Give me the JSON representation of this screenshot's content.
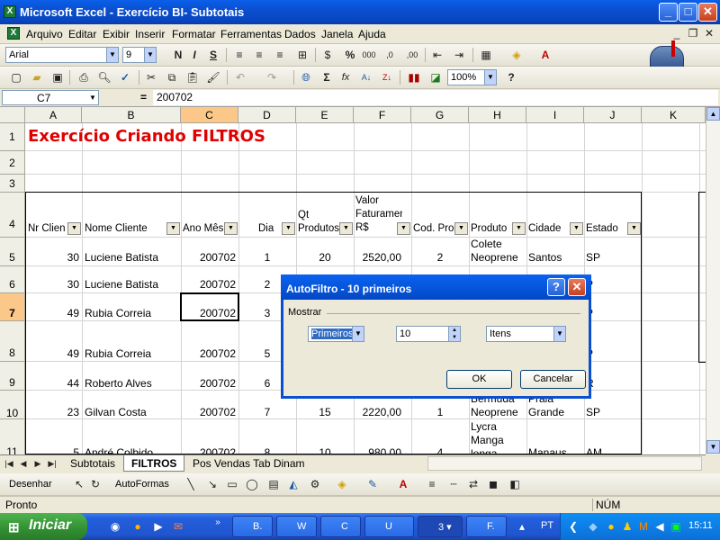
{
  "window": {
    "title": "Microsoft Excel - Exercício BI- Subtotais",
    "min": "_",
    "max": "□",
    "close": "✕"
  },
  "menu": [
    "Arquivo",
    "Editar",
    "Exibir",
    "Inserir",
    "Formatar",
    "Ferramentas",
    "Dados",
    "Janela",
    "Ajuda"
  ],
  "format_toolbar": {
    "font": "Arial",
    "size": "9",
    "bold": "N",
    "italic": "I",
    "underline": "S",
    "percent": "%",
    "thousands": "000"
  },
  "std_toolbar": {
    "zoom": "100%",
    "sigma": "Σ",
    "fx": "fx"
  },
  "formula_bar": {
    "name_box": "C7",
    "equals": "=",
    "value": "200702"
  },
  "columns": [
    "A",
    "B",
    "C",
    "D",
    "E",
    "F",
    "G",
    "H",
    "I",
    "J",
    "K"
  ],
  "rows": [
    "1",
    "2",
    "3",
    "4",
    "5",
    "6",
    "7",
    "8",
    "9",
    "10",
    "11"
  ],
  "sheet_title": "Exercício Criando FILTROS",
  "headers": {
    "nr_cliente": "Nr Clien",
    "nome_cliente": "Nome Cliente",
    "ano_mes": "Ano Mês",
    "dia": "Dia",
    "qt_produtos": "Qt Produtos",
    "faturamento": "Valor Faturamento R$",
    "cod_prod": "Cod. Pro",
    "produto": "Produto",
    "cidade": "Cidade",
    "estado": "Estado"
  },
  "data_rows": [
    {
      "nr": "30",
      "nome": "Luciene Batista",
      "ano": "200702",
      "dia": "1",
      "qt": "20",
      "valor": "2520,00",
      "cod": "2",
      "produto": "Colete Neoprene",
      "cidade": "Santos",
      "estado": "SP"
    },
    {
      "nr": "30",
      "nome": "Luciene Batista",
      "ano": "200702",
      "dia": "2",
      "qt": "",
      "valor": "",
      "cod": "",
      "produto": "",
      "cidade": "",
      "estado": "P"
    },
    {
      "nr": "49",
      "nome": "Rubia Correia",
      "ano": "200702",
      "dia": "3",
      "qt": "",
      "valor": "",
      "cod": "",
      "produto": "",
      "cidade": "",
      "estado": "P"
    },
    {
      "nr": "49",
      "nome": "Rubia Correia",
      "ano": "200702",
      "dia": "5",
      "qt": "",
      "valor": "",
      "cod": "",
      "produto": "",
      "cidade": "",
      "estado": "P"
    },
    {
      "nr": "44",
      "nome": "Roberto Alves",
      "ano": "200702",
      "dia": "6",
      "qt": "",
      "valor": "",
      "cod": "",
      "produto": "",
      "cidade": "",
      "estado": "R"
    },
    {
      "nr": "23",
      "nome": "Gilvan Costa",
      "ano": "200702",
      "dia": "7",
      "qt": "15",
      "valor": "2220,00",
      "cod": "1",
      "produto": "Bermuda Neoprene",
      "cidade": "Praia Grande",
      "estado": "SP"
    },
    {
      "nr": "5",
      "nome": "André Colbido",
      "ano": "200702",
      "dia": "8",
      "qt": "10",
      "valor": "980,00",
      "cod": "4",
      "produto": "Lycra Manga longa",
      "cidade": "Manaus",
      "estado": "AM"
    }
  ],
  "dialog": {
    "title": "AutoFiltro - 10 primeiros",
    "help": "?",
    "close": "✕",
    "group_label": "Mostrar",
    "type_value": "Primeiros",
    "count_value": "10",
    "unit_value": "Itens",
    "ok": "OK",
    "cancel": "Cancelar"
  },
  "sheet_tabs": [
    "Subtotais",
    "FILTROS",
    "Pos Vendas Tab Dinam"
  ],
  "active_tab": "FILTROS",
  "draw_toolbar": {
    "desenhar": "Desenhar",
    "autoformas": "AutoFormas"
  },
  "status": {
    "left": "Pronto",
    "num": "NÚM"
  },
  "taskbar": {
    "start": "Iniciar",
    "tasks": [
      "B.",
      "W",
      "C",
      "U",
      "3",
      "F."
    ],
    "lang": "PT",
    "clock": "15:11"
  }
}
